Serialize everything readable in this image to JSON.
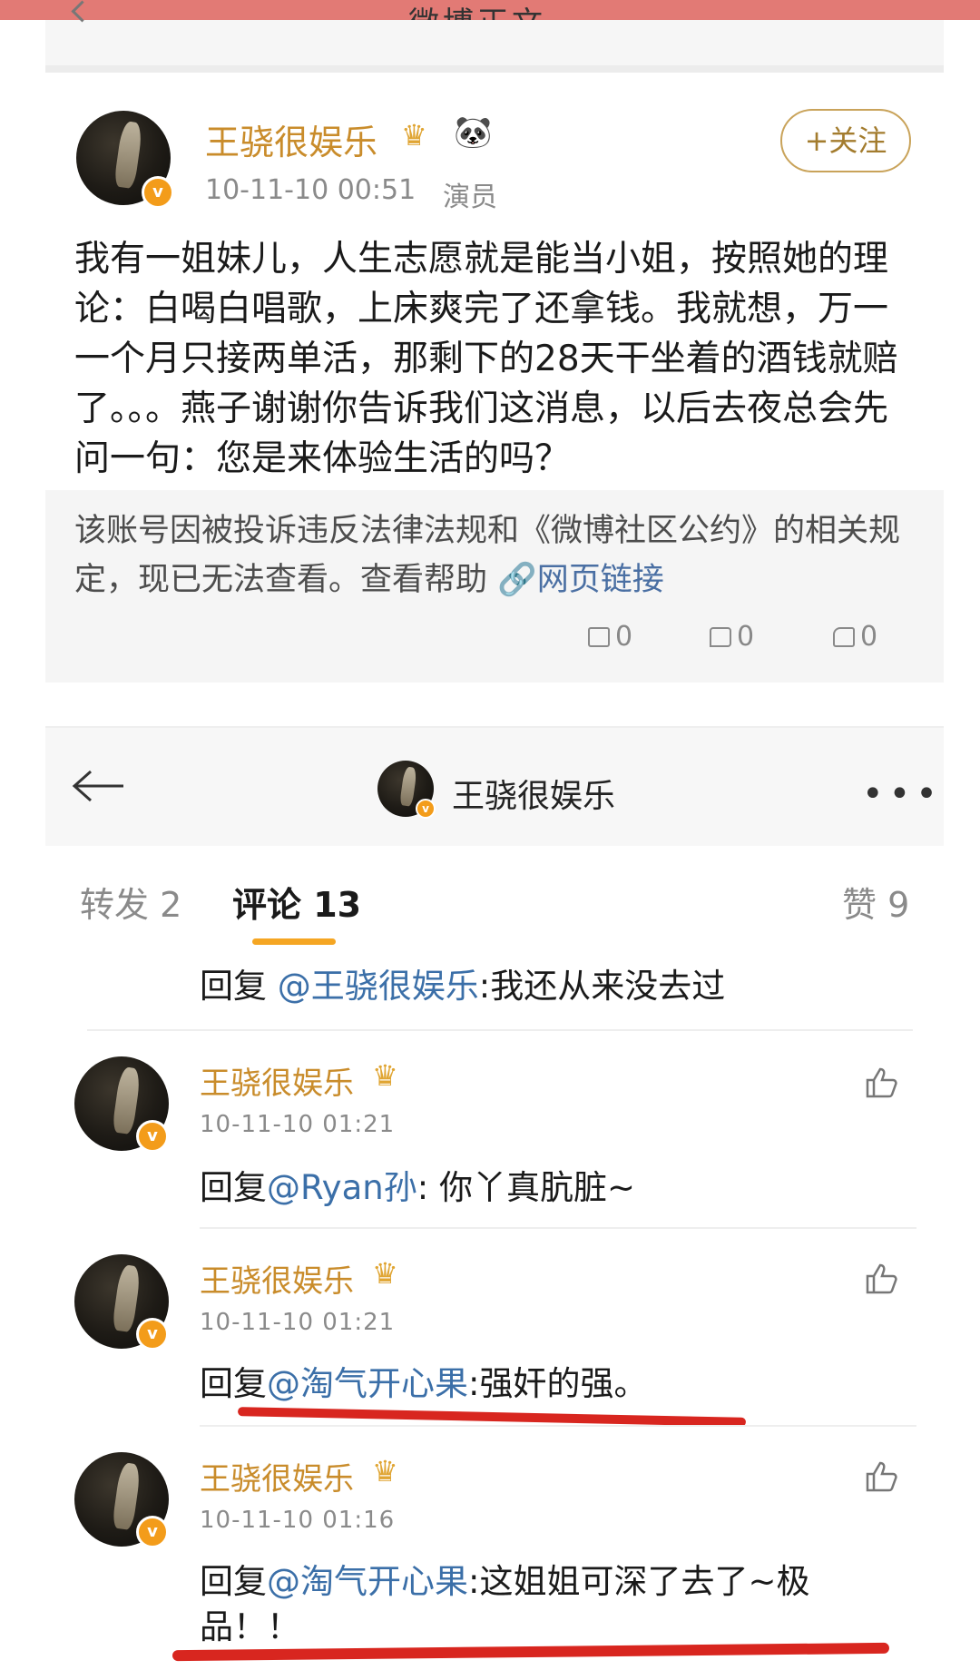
{
  "top_bar": {
    "title": "微博正文"
  },
  "post": {
    "author": "王骁很娱乐",
    "author_emoji": "🐼",
    "time": "10-11-10 00:51",
    "source": "演员",
    "follow_label": "+关注",
    "content": "我有一姐妹儿，人生志愿就是能当小姐，按照她的理论：白喝白唱歌，上床爽完了还拿钱。我就想，万一一个月只接两单活，那剩下的28天干坐着的酒钱就赔了。。。燕子谢谢你告诉我们这消息，以后去夜总会先问一句：您是来体验生活的吗？",
    "notice": "该账号因被投诉违反法律法规和《微博社区公约》的相关规定，现已无法查看。查看帮助",
    "notice_link": "网页链接",
    "repost_count": "0",
    "comment_count": "0",
    "like_count": "0"
  },
  "nav": {
    "title": "王骁很娱乐",
    "more": "•••"
  },
  "tabs": {
    "repost": "转发 2",
    "comment": "评论 13",
    "like": "赞 9"
  },
  "comments": [
    {
      "reply_prefix": "回复 ",
      "mention": "@王骁很娱乐",
      "text": ":我还从来没去过"
    },
    {
      "author": "王骁很娱乐",
      "time": "10-11-10 01:21",
      "reply_prefix": "回复",
      "mention": "@Ryan孙",
      "text": ": 你丫真肮脏~"
    },
    {
      "author": "王骁很娱乐",
      "time": "10-11-10 01:21",
      "reply_prefix": "回复",
      "mention": "@淘气开心果",
      "text": ":强奸的强。"
    },
    {
      "author": "王骁很娱乐",
      "time": "10-11-10 01:16",
      "reply_prefix": "回复",
      "mention": "@淘气开心果",
      "text": ":这姐姐可深了去了~极",
      "text_line2": "品！！"
    }
  ],
  "colors": {
    "accent": "#f5a623",
    "name": "#c98c2b",
    "mention": "#3b6fa8",
    "annotation": "#d8261f"
  }
}
